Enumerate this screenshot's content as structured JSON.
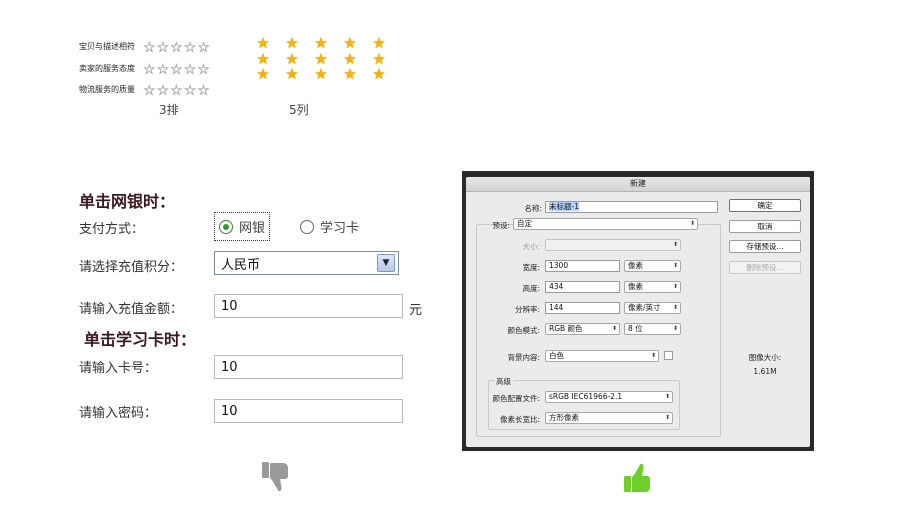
{
  "rating": {
    "rows": [
      "宝贝与描述相符",
      "卖家的服务态度",
      "物流服务的质量"
    ],
    "captions": {
      "rows": "3排",
      "columns": "5列"
    },
    "empty_star_count": 5,
    "full_star_count": 5,
    "star_color": "#f6b400"
  },
  "bad_form": {
    "bank_section_title": "单击网银时：",
    "payment_label": "支付方式：",
    "payment_options": [
      "网银",
      "学习卡"
    ],
    "payment_selected": "网银",
    "points_label": "请选择充值积分：",
    "points_value": "人民币",
    "amount_label": "请输入充值金额：",
    "amount_value": "10",
    "amount_unit": "元",
    "card_section_title": "单击学习卡时：",
    "card_number_label": "请输入卡号：",
    "card_number_value": "10",
    "password_label": "请输入密码：",
    "password_value": "10"
  },
  "dialog": {
    "title": "新建",
    "name_label": "名称:",
    "name_value": "未标题-1",
    "preset_label": "预设:",
    "preset_value": "自定",
    "size_label": "大小:",
    "size_value": "",
    "width_label": "宽度:",
    "width_value": "1300",
    "width_unit": "像素",
    "height_label": "高度:",
    "height_value": "434",
    "height_unit": "像素",
    "resolution_label": "分辨率:",
    "resolution_value": "144",
    "resolution_unit": "像素/英寸",
    "color_mode_label": "颜色模式:",
    "color_mode_value": "RGB 颜色",
    "bit_depth_value": "8 位",
    "bg_label": "背景内容:",
    "bg_value": "白色",
    "advanced_label": "高级",
    "profile_label": "颜色配置文件:",
    "profile_value": "sRGB IEC61966-2.1",
    "aspect_label": "像素长宽比:",
    "aspect_value": "方形像素",
    "buttons": {
      "ok": "确定",
      "cancel": "取消",
      "save_preset": "存储预设...",
      "delete_preset": "删除预设..."
    },
    "image_size_label": "图像大小:",
    "image_size_value": "1.61M"
  },
  "icons": {
    "thumbs_down": {
      "name": "thumbs-down-icon",
      "color": "#9a9a9a"
    },
    "thumbs_up": {
      "name": "thumbs-up-icon",
      "color": "#6fcf2a"
    }
  }
}
